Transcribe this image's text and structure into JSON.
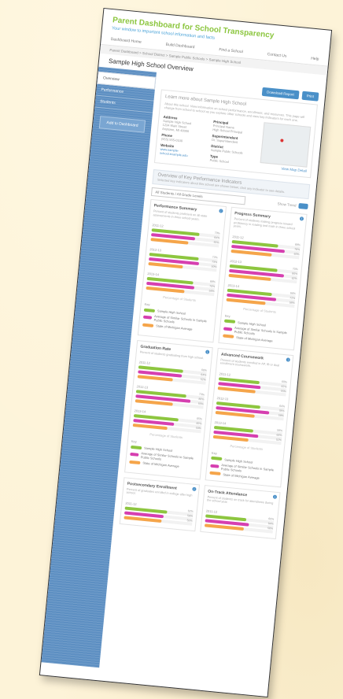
{
  "header": {
    "title": "Parent Dashboard for School Transparency",
    "subtitle": "Your window to important school information and facts"
  },
  "nav": [
    "Dashboard Home",
    "Build Dashboard",
    "Find a School",
    "Contact Us",
    "Help"
  ],
  "breadcrumb": "Parent Dashboard > School District > Sample Public Schools > Sample High School",
  "page_title": "Sample High School Overview",
  "sidebar": {
    "selected": "Overview",
    "items": [
      "Performance",
      "Students"
    ],
    "button": "Add to Dashboard"
  },
  "buttons": [
    "Download Report",
    "Print"
  ],
  "learn": {
    "heading": "Learn more about Sample High School",
    "text": "About this school. View information on school performance, enrollment, and resources. This page will change from school to school as you explore other schools and view key indicators for each one.",
    "address_label": "Address",
    "address": "Sample High School\n1234 Main Street\nAnytown, MI 48000",
    "phone_label": "Phone",
    "phone": "(555) 555-0100",
    "website_label": "Website",
    "website": "www.sample-school.example.edu",
    "principal_label": "Principal",
    "principal": "Principal Name\nHigh School Principal",
    "superintendent_label": "Superintendent",
    "superintendent": "Dr. Superintendent",
    "district_label": "District",
    "district": "Sample Public Schools",
    "type_label": "Type",
    "type": "Public School",
    "view_map": "View Map Detail"
  },
  "overview": {
    "heading": "Overview of Key Performance Indicators",
    "sub": "Selected key indicators about this school are shown below; click any indicator to see details.",
    "select": "All Students / All Grade Levels",
    "toggle": "Show Trend"
  },
  "colors": {
    "green": "#8dc63f",
    "magenta": "#d63fb0",
    "purple": "#8e3fb0",
    "orange": "#f5a54a",
    "blue": "#4a90c8"
  },
  "cards": [
    {
      "title": "Performance Summary",
      "desc": "Percent of students proficient on all state assessments in three school years.",
      "years": [
        "2011-12",
        "2012-13",
        "2013-14"
      ],
      "values": [
        [
          0.7,
          0.64,
          0.55
        ],
        [
          0.72,
          0.73,
          0.5
        ],
        [
          0.68,
          0.7,
          0.56
        ]
      ],
      "value_labels": [
        [
          "70%",
          "64%",
          "55%"
        ],
        [
          "72%",
          "73%",
          "50%"
        ],
        [
          "68%",
          "70%",
          "56%"
        ]
      ],
      "axis": "Percentage of Students"
    },
    {
      "title": "Progress Summary",
      "desc": "Percent of students making progress toward proficiency in reading and math in three school years.",
      "years": [
        "2011-12",
        "2012-13",
        "2013-14"
      ],
      "values": [
        [
          0.68,
          0.78,
          0.6
        ],
        [
          0.7,
          0.8,
          0.62
        ],
        [
          0.66,
          0.72,
          0.58
        ]
      ],
      "value_labels": [
        [
          "68%",
          "78%",
          "60%"
        ],
        [
          "70%",
          "80%",
          "62%"
        ],
        [
          "66%",
          "72%",
          "58%"
        ]
      ],
      "axis": "Percentage of Students"
    },
    {
      "title": "Graduation Rate",
      "desc": "Percent of students graduating from high school.",
      "years": [
        "2011-12",
        "2012-13",
        "2013-14"
      ],
      "values": [
        [
          0.66,
          0.64,
          0.52
        ],
        [
          0.73,
          0.8,
          0.55
        ],
        [
          0.65,
          0.6,
          0.5
        ]
      ],
      "value_labels": [
        [
          "66%",
          "64%",
          "52%"
        ],
        [
          "73%",
          "80%",
          "55%"
        ],
        [
          "65%",
          "60%",
          "50%"
        ]
      ],
      "axis": "Percentage of Students"
    },
    {
      "title": "Advanced Coursework",
      "desc": "Percent of students enrolled in AP, IB or dual enrollment coursework.",
      "years": [
        "2011-12",
        "2012-13",
        "2013-14"
      ],
      "values": [
        [
          0.6,
          0.62,
          0.55
        ],
        [
          0.64,
          0.78,
          0.58
        ],
        [
          0.58,
          0.66,
          0.52
        ]
      ],
      "value_labels": [
        [
          "60%",
          "62%",
          "55%"
        ],
        [
          "64%",
          "78%",
          "58%"
        ],
        [
          "58%",
          "66%",
          "52%"
        ]
      ],
      "axis": "Percentage of Students"
    },
    {
      "title": "Postsecondary Enrollment",
      "desc": "Percent of graduates enrolled in college after high school.",
      "years": [
        "2011-12"
      ],
      "values": [
        [
          0.62,
          0.58,
          0.55
        ]
      ],
      "value_labels": [
        [
          "62%",
          "58%",
          "55%"
        ]
      ],
      "axis": ""
    },
    {
      "title": "On-Track Attendance",
      "desc": "Percent of students on track for attendance during the school year.",
      "years": [
        "2011-12"
      ],
      "values": [
        [
          0.6,
          0.64,
          0.58
        ]
      ],
      "value_labels": [
        [
          "60%",
          "64%",
          "58%"
        ]
      ],
      "axis": ""
    }
  ],
  "legend_key": "Key",
  "legend": [
    {
      "label": "Sample High School",
      "color": "#8dc63f"
    },
    {
      "label": "Average of Similar Schools in Sample Public Schools",
      "color": "#d63fb0"
    },
    {
      "label": "State of Michigan Average",
      "color": "#f5a54a"
    }
  ]
}
